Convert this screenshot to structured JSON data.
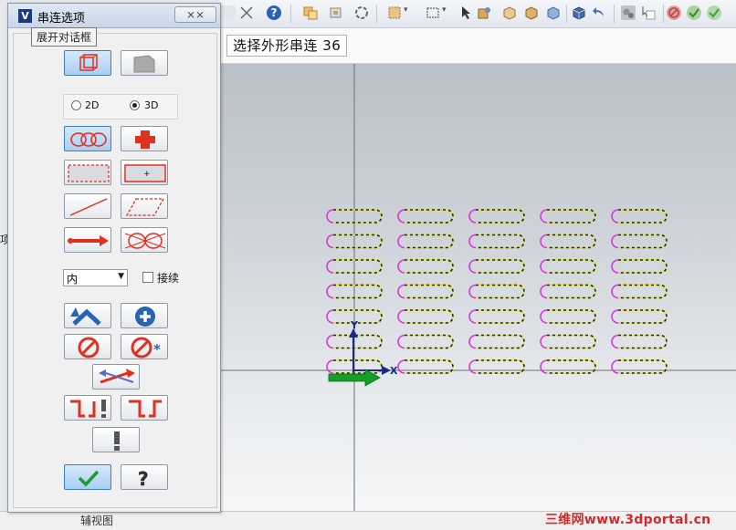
{
  "dialog": {
    "title": "串连选项",
    "close_label": "⨯⨯",
    "tooltip": "展开对话框",
    "mode_2d_label": "2D",
    "mode_3d_label": "3D",
    "selected_mode": "3D",
    "direction_combo_value": "内",
    "continue_checkbox_label": "接续",
    "continue_checked": false,
    "ok_icon": "checkmark-icon",
    "help_icon": "question-icon"
  },
  "chain_status": {
    "text": "选择外形串连  36"
  },
  "viewport": {
    "axis_x_label": "X",
    "axis_y_label": "Y",
    "slot_columns": 5,
    "slot_rows": 7,
    "slot_outline_color": "#e8e820",
    "slot_arc_color": "#d43ad4",
    "grid_line_color": "#6a6f78"
  },
  "background": {
    "left_clip_text": "项面",
    "bottom_label": "辅视图"
  },
  "watermark": "三维网www.3dportal.cn",
  "colors": {
    "accent_red": "#e0301e",
    "accent_blue": "#3c7fc1",
    "dialog_bg": "#f0f0f0"
  }
}
